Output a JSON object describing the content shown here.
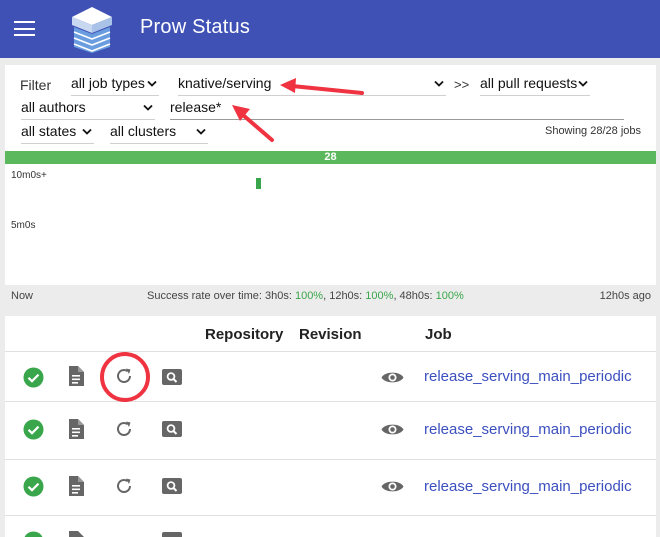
{
  "app": {
    "title": "Prow Status"
  },
  "filters": {
    "label": "Filter",
    "job_type": "all job types",
    "repo": "knative/serving",
    "separator": ">>",
    "pull_requests": "all pull requests",
    "authors": "all authors",
    "job_name": "release*",
    "states": "all states",
    "clusters": "all clusters",
    "showing": "Showing 28/28 jobs"
  },
  "histogram": {
    "count": "28",
    "y_top": "10m0s+",
    "y_mid": "5m0s"
  },
  "footer": {
    "left": "Now",
    "success_prefix": "Success rate over time: 3h0s: ",
    "rate_3h": "100%",
    "sep_12h": ", 12h0s: ",
    "rate_12h": "100%",
    "sep_48h": ", 48h0s: ",
    "rate_48h": "100%",
    "right": "12h0s ago"
  },
  "table": {
    "headers": {
      "repository": "Repository",
      "revision": "Revision",
      "job": "Job"
    },
    "rows": [
      {
        "status": "success",
        "job": "release_serving_main_periodic"
      },
      {
        "status": "success",
        "job": "release_serving_main_periodic"
      },
      {
        "status": "success",
        "job": "release_serving_main_periodic"
      }
    ]
  },
  "colors": {
    "header": "#3f51b5",
    "success": "#3aa64b",
    "link": "#3b4fbf",
    "annotation": "#ef3340"
  }
}
